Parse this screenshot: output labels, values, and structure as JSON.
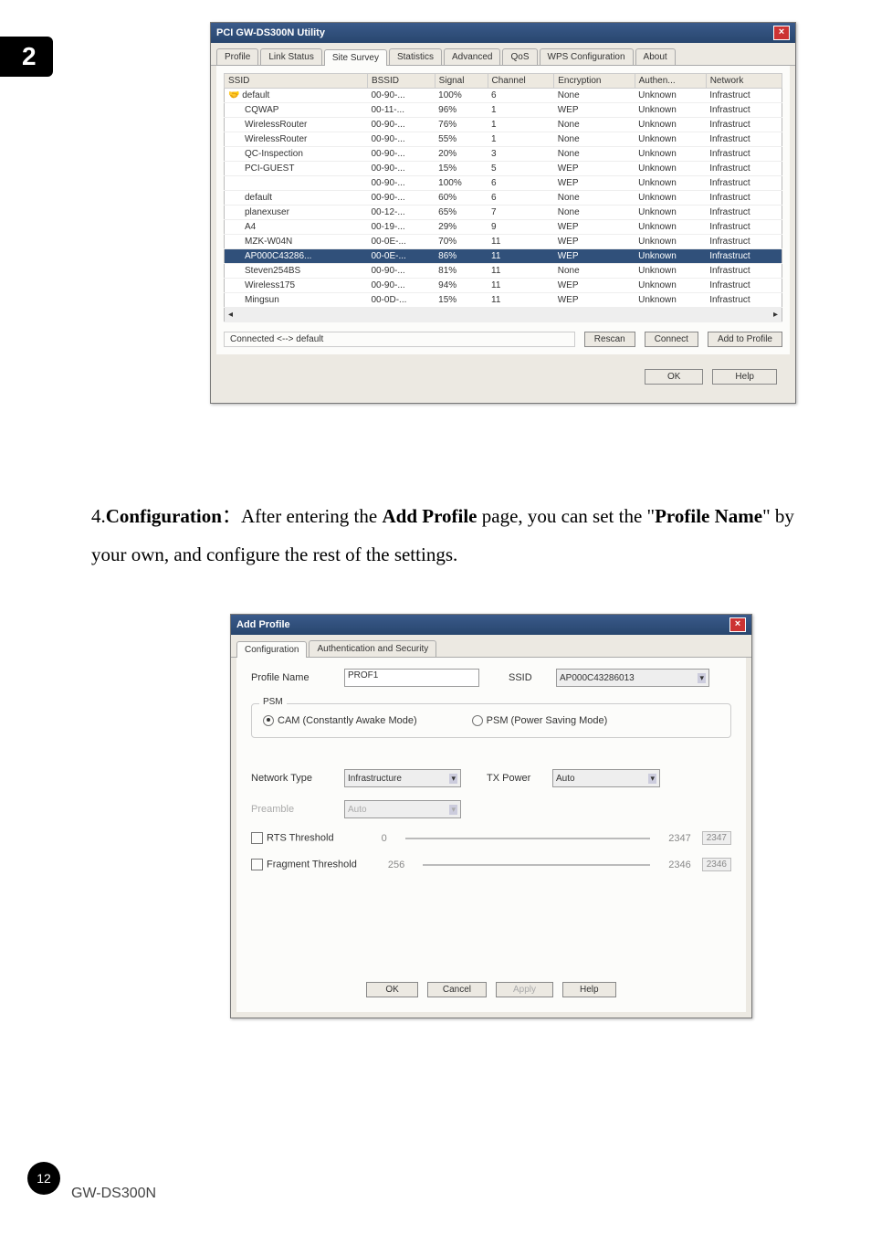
{
  "chapter": "2",
  "page_number": "12",
  "product": "GW-DS300N",
  "dialog1": {
    "title": "PCI GW-DS300N Utility",
    "tabs": [
      "Profile",
      "Link Status",
      "Site Survey",
      "Statistics",
      "Advanced",
      "QoS",
      "WPS Configuration",
      "About"
    ],
    "active_tab_index": 2,
    "columns": [
      "SSID",
      "BSSID",
      "Signal",
      "Channel",
      "Encryption",
      "Authen...",
      "Network"
    ],
    "rows": [
      {
        "ssid": "default",
        "bssid": "00-90-...",
        "signal": "100%",
        "channel": "6",
        "enc": "None",
        "auth": "Unknown",
        "net": "Infrastruct",
        "icon": true
      },
      {
        "ssid": "CQWAP",
        "bssid": "00-11-...",
        "signal": "96%",
        "channel": "1",
        "enc": "WEP",
        "auth": "Unknown",
        "net": "Infrastruct"
      },
      {
        "ssid": "WirelessRouter",
        "bssid": "00-90-...",
        "signal": "76%",
        "channel": "1",
        "enc": "None",
        "auth": "Unknown",
        "net": "Infrastruct"
      },
      {
        "ssid": "WirelessRouter",
        "bssid": "00-90-...",
        "signal": "55%",
        "channel": "1",
        "enc": "None",
        "auth": "Unknown",
        "net": "Infrastruct"
      },
      {
        "ssid": "QC-Inspection",
        "bssid": "00-90-...",
        "signal": "20%",
        "channel": "3",
        "enc": "None",
        "auth": "Unknown",
        "net": "Infrastruct"
      },
      {
        "ssid": "PCI-GUEST",
        "bssid": "00-90-...",
        "signal": "15%",
        "channel": "5",
        "enc": "WEP",
        "auth": "Unknown",
        "net": "Infrastruct"
      },
      {
        "ssid": "",
        "bssid": "00-90-...",
        "signal": "100%",
        "channel": "6",
        "enc": "WEP",
        "auth": "Unknown",
        "net": "Infrastruct"
      },
      {
        "ssid": "default",
        "bssid": "00-90-...",
        "signal": "60%",
        "channel": "6",
        "enc": "None",
        "auth": "Unknown",
        "net": "Infrastruct"
      },
      {
        "ssid": "planexuser",
        "bssid": "00-12-...",
        "signal": "65%",
        "channel": "7",
        "enc": "None",
        "auth": "Unknown",
        "net": "Infrastruct"
      },
      {
        "ssid": "A4",
        "bssid": "00-19-...",
        "signal": "29%",
        "channel": "9",
        "enc": "WEP",
        "auth": "Unknown",
        "net": "Infrastruct"
      },
      {
        "ssid": "MZK-W04N",
        "bssid": "00-0E-...",
        "signal": "70%",
        "channel": "11",
        "enc": "WEP",
        "auth": "Unknown",
        "net": "Infrastruct"
      },
      {
        "ssid": "AP000C43286...",
        "bssid": "00-0E-...",
        "signal": "86%",
        "channel": "11",
        "enc": "WEP",
        "auth": "Unknown",
        "net": "Infrastruct",
        "selected": true
      },
      {
        "ssid": "Steven254BS",
        "bssid": "00-90-...",
        "signal": "81%",
        "channel": "11",
        "enc": "None",
        "auth": "Unknown",
        "net": "Infrastruct"
      },
      {
        "ssid": "Wireless175",
        "bssid": "00-90-...",
        "signal": "94%",
        "channel": "11",
        "enc": "WEP",
        "auth": "Unknown",
        "net": "Infrastruct"
      },
      {
        "ssid": "Mingsun",
        "bssid": "00-0D-...",
        "signal": "15%",
        "channel": "11",
        "enc": "WEP",
        "auth": "Unknown",
        "net": "Infrastruct"
      }
    ],
    "status": "Connected <--> default",
    "rescan": "Rescan",
    "connect": "Connect",
    "add_profile": "Add to Profile",
    "ok": "OK",
    "help": "Help"
  },
  "body_text": {
    "num": "4.",
    "term": "Configuration",
    "sep": "：",
    "part1": "After entering the ",
    "bold1": "Add Profile",
    "part2": " page, you can set the \"",
    "bold2": "Profile Name",
    "part3": "\" by your own, and configure the rest of the settings."
  },
  "dialog2": {
    "title": "Add Profile",
    "tabs": [
      "Configuration",
      "Authentication and Security"
    ],
    "active_tab_index": 0,
    "labels": {
      "profile_name": "Profile Name",
      "ssid": "SSID",
      "psm": "PSM",
      "cam": "CAM (Constantly Awake Mode)",
      "psm_mode": "PSM (Power Saving Mode)",
      "net_type": "Network Type",
      "tx_power": "TX Power",
      "preamble": "Preamble",
      "rts": "RTS Threshold",
      "frag": "Fragment Threshold"
    },
    "values": {
      "profile_name": "PROF1",
      "ssid": "AP000C43286013",
      "net_type": "Infrastructure",
      "tx_power": "Auto",
      "preamble": "Auto",
      "rts_min": "0",
      "rts_val": "2347",
      "rts_ro": "2347",
      "frag_min": "256",
      "frag_val": "2346",
      "frag_ro": "2346"
    },
    "buttons": {
      "ok": "OK",
      "cancel": "Cancel",
      "apply": "Apply",
      "help": "Help"
    }
  }
}
